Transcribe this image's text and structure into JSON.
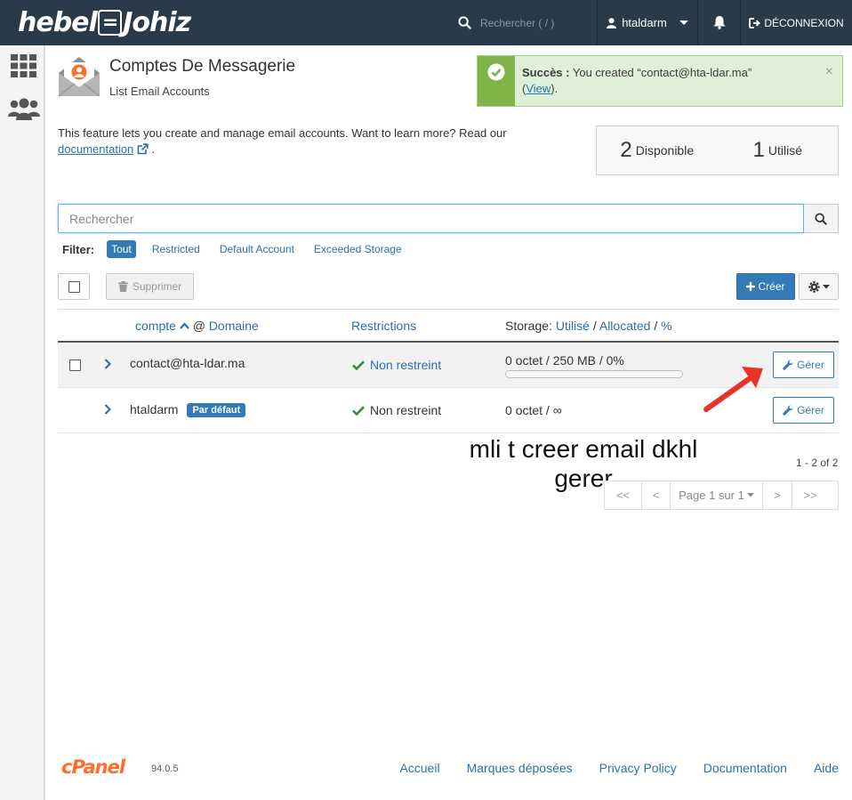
{
  "header": {
    "logo_text_left": "hebel",
    "logo_text_mark": "=",
    "logo_text_right": "Johiz",
    "search_placeholder": "Rechercher ( / )",
    "username": "htaldarm",
    "logout_label": "DÉCONNEXION"
  },
  "page": {
    "title": "Comptes De Messagerie",
    "subtitle": "List Email Accounts",
    "intro_text": "This feature lets you create and manage email accounts. Want to learn more? Read our",
    "intro_link": "documentation",
    "intro_end": "."
  },
  "alert": {
    "title": "Succès :",
    "message": "You created “contact@hta-ldar.ma”",
    "open_paren": "(",
    "link": "View",
    "close_paren": ")."
  },
  "stats": {
    "available_count": "2",
    "available_label": "Disponible",
    "used_count": "1",
    "used_label": "Utilisé"
  },
  "search": {
    "placeholder": "Rechercher"
  },
  "filters": {
    "label": "Filter:",
    "items": [
      "Tout",
      "Restricted",
      "Default Account",
      "Exceeded Storage"
    ],
    "active": "Tout"
  },
  "toolbar": {
    "delete_label": "Supprimer",
    "create_label": "Créer"
  },
  "table": {
    "col_account": "compte",
    "col_at": "@",
    "col_domain": "Domaine",
    "col_restrictions": "Restrictions",
    "col_storage_prefix": "Storage:",
    "col_storage_used": "Utilisé",
    "col_storage_sep": "/",
    "col_storage_alloc": "Allocated",
    "col_storage_pct": "%",
    "rows": [
      {
        "account": "contact@hta-ldar.ma",
        "badge": "",
        "restriction": "Non restreint",
        "storage": "0 octet / 250 MB / 0%",
        "usage_fraction": 0,
        "action": "Gérer"
      },
      {
        "account": "htaldarm",
        "badge": "Par défaut",
        "restriction": "Non restreint",
        "storage": "0 octet / ∞",
        "usage_fraction": null,
        "action": "Gérer"
      }
    ]
  },
  "pagination": {
    "count": "1 - 2 of 2",
    "first": "<<",
    "prev": "<",
    "page_label": "Page 1 sur 1",
    "next": ">",
    "last": ">>"
  },
  "annotation": {
    "text": "mli t creer email dkhl gerer",
    "arrow_color": "#e8332b"
  },
  "footer": {
    "logo": "cPanel",
    "version": "94.0.5",
    "links": [
      "Accueil",
      "Marques déposées",
      "Privacy Policy",
      "Documentation",
      "Aide"
    ]
  },
  "colors": {
    "topbar": "#293a4a",
    "primary": "#337ab7",
    "link": "#2c6fad",
    "success_bg": "#dff0d8",
    "success_accent": "#7fb446",
    "check_green": "#3a8a3a",
    "cpanel_orange": "#ff6c2c"
  }
}
